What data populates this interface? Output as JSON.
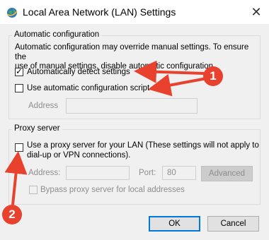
{
  "window": {
    "title": "Local Area Network (LAN) Settings",
    "close_icon": "close-icon"
  },
  "auto_config": {
    "group_label": "Automatic configuration",
    "description": "Automatic configuration may override manual settings.  To ensure the\nuse of manual settings, disable automatic configuration.",
    "detect_label": "Automatically detect settings",
    "detect_checked": true,
    "script_label": "Use automatic configuration script",
    "script_checked": false,
    "address_label": "Address",
    "address_value": ""
  },
  "proxy": {
    "group_label": "Proxy server",
    "use_proxy_label": "Use a proxy server for your LAN (These settings will not apply to\ndial-up or VPN connections).",
    "use_proxy_checked": false,
    "address_label": "Address:",
    "address_value": "",
    "port_label": "Port:",
    "port_value": "80",
    "advanced_label": "Advanced",
    "bypass_label": "Bypass proxy server for local addresses",
    "bypass_checked": false
  },
  "buttons": {
    "ok": "OK",
    "cancel": "Cancel"
  },
  "annotations": {
    "badge1": "1",
    "badge2": "2",
    "color": "#e8412e"
  }
}
